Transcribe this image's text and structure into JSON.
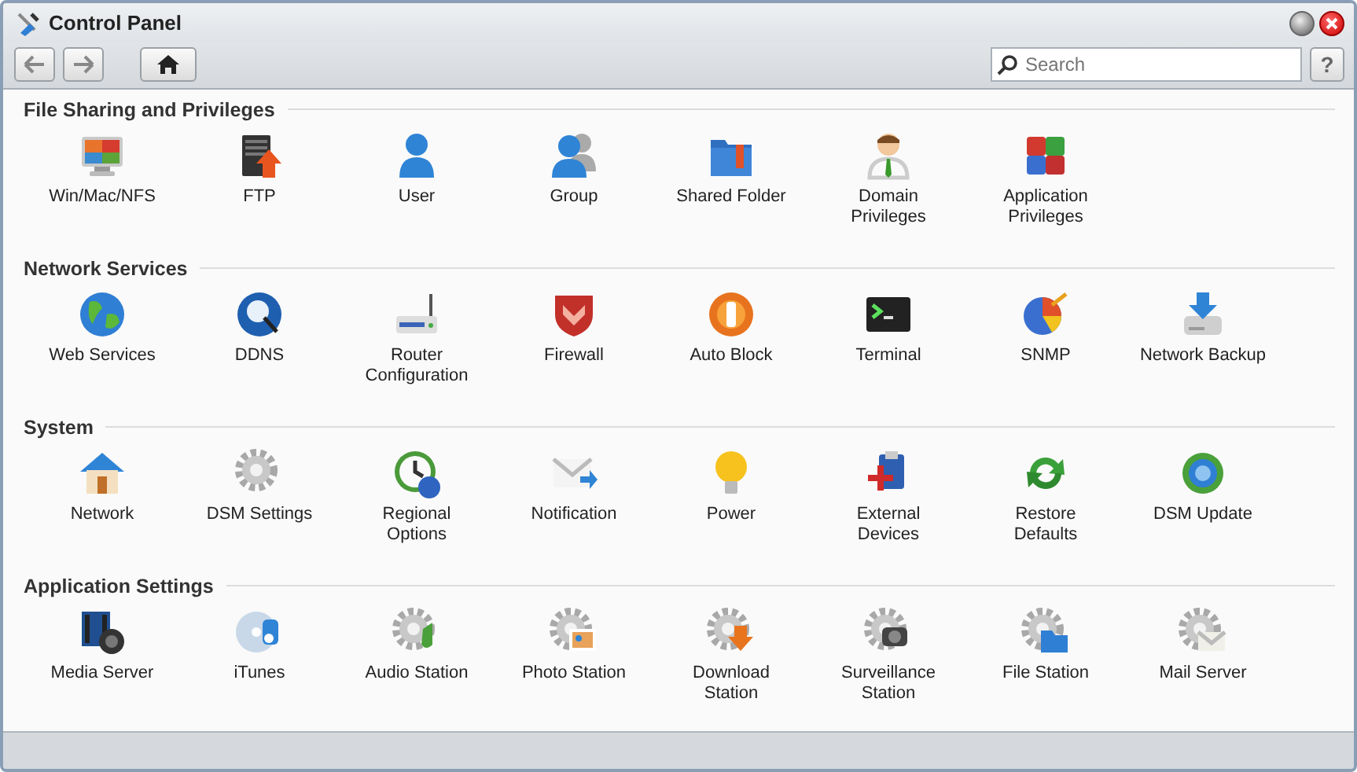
{
  "window": {
    "title": "Control Panel"
  },
  "toolbar": {
    "search": {
      "placeholder": "Search"
    },
    "help": "?"
  },
  "sections": [
    {
      "title": "File Sharing and Privileges",
      "items": [
        {
          "label": "Win/Mac/NFS"
        },
        {
          "label": "FTP"
        },
        {
          "label": "User"
        },
        {
          "label": "Group"
        },
        {
          "label": "Shared Folder"
        },
        {
          "label": "Domain\nPrivileges"
        },
        {
          "label": "Application\nPrivileges"
        }
      ]
    },
    {
      "title": "Network Services",
      "items": [
        {
          "label": "Web Services"
        },
        {
          "label": "DDNS"
        },
        {
          "label": "Router\nConfiguration"
        },
        {
          "label": "Firewall"
        },
        {
          "label": "Auto Block"
        },
        {
          "label": "Terminal"
        },
        {
          "label": "SNMP"
        },
        {
          "label": "Network Backup"
        }
      ]
    },
    {
      "title": "System",
      "items": [
        {
          "label": "Network"
        },
        {
          "label": "DSM Settings"
        },
        {
          "label": "Regional\nOptions"
        },
        {
          "label": "Notification"
        },
        {
          "label": "Power"
        },
        {
          "label": "External\nDevices"
        },
        {
          "label": "Restore\nDefaults"
        },
        {
          "label": "DSM Update"
        }
      ]
    },
    {
      "title": "Application Settings",
      "items": [
        {
          "label": "Media Server"
        },
        {
          "label": "iTunes"
        },
        {
          "label": "Audio Station"
        },
        {
          "label": "Photo Station"
        },
        {
          "label": "Download\nStation"
        },
        {
          "label": "Surveillance\nStation"
        },
        {
          "label": "File Station"
        },
        {
          "label": "Mail Server"
        }
      ]
    }
  ]
}
